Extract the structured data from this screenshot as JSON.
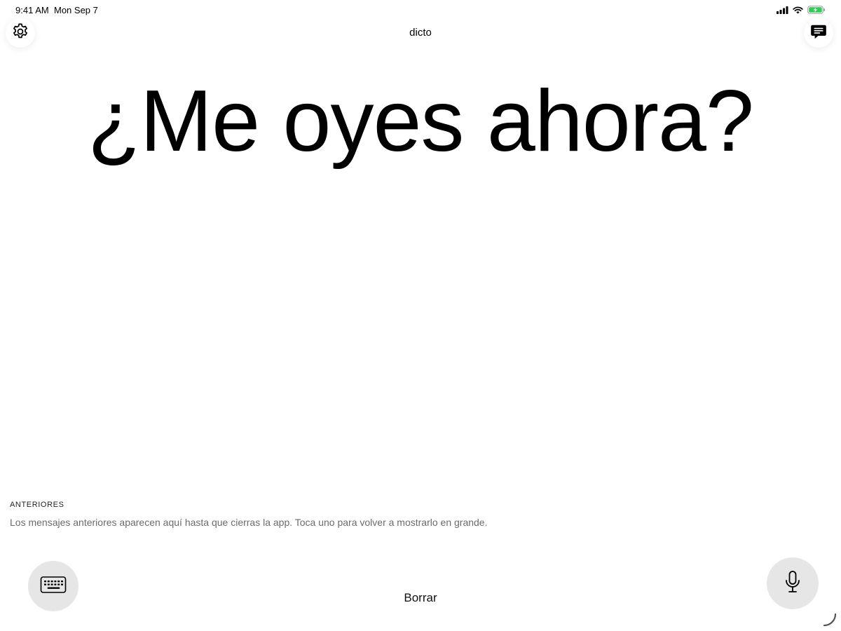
{
  "status_bar": {
    "time": "9:41 AM",
    "date": "Mon Sep 7",
    "signal_icon": "cellular-signal-icon",
    "wifi_icon": "wifi-icon",
    "battery_icon": "battery-charging-icon",
    "battery_color": "#34c759"
  },
  "header": {
    "title": "dicto",
    "settings_icon": "gear-icon",
    "messages_icon": "chat-bubble-icon"
  },
  "main": {
    "message": "¿Me oyes ahora?"
  },
  "history": {
    "heading": "ANTERIORES",
    "hint": "Los mensajes anteriores aparecen aquí hasta que cierras la app. Toca uno para volver a mostrarlo en grande."
  },
  "controls": {
    "keyboard_icon": "keyboard-icon",
    "clear_label": "Borrar",
    "mic_icon": "microphone-icon"
  }
}
